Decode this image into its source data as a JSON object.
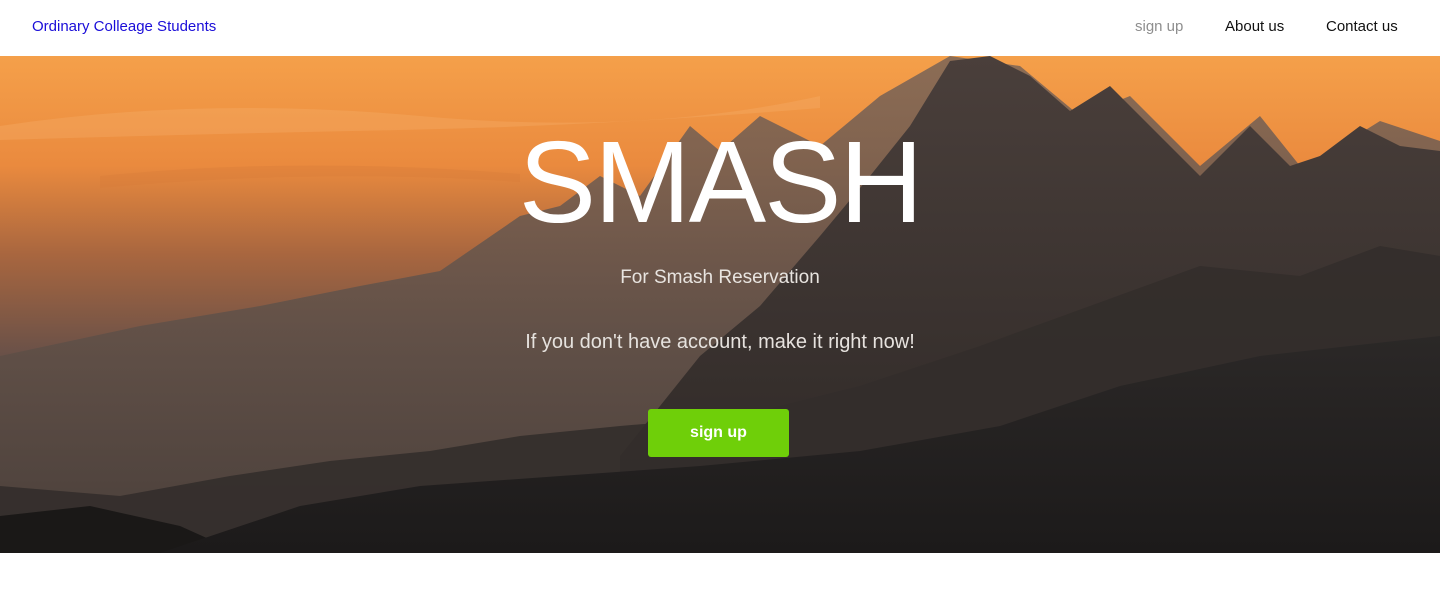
{
  "navbar": {
    "brand": "Ordinary Colleage Students",
    "links": [
      {
        "label": "sign up"
      },
      {
        "label": "About us"
      },
      {
        "label": "Contact us"
      }
    ]
  },
  "hero": {
    "title": "SMASH",
    "subtitle": "For Smash Reservation",
    "cta_text": "If you don't have account, make it right now!",
    "button_label": "sign up",
    "button_color": "#6fcf09"
  },
  "colors": {
    "brand_link": "#1a0dd8",
    "muted_link": "#8e8e8e"
  }
}
